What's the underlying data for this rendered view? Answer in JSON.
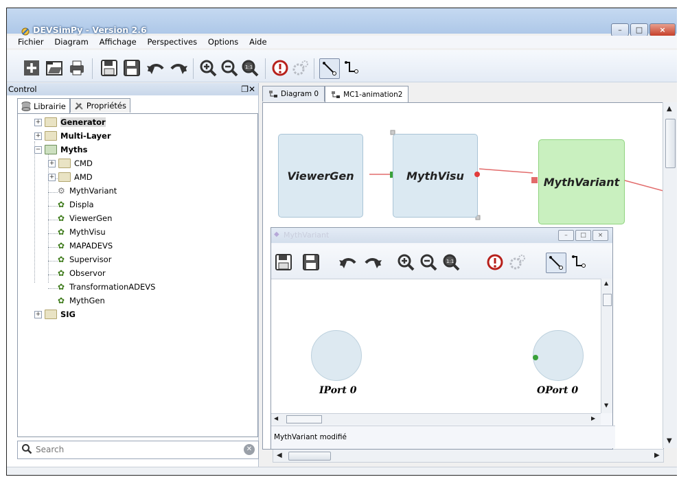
{
  "window": {
    "title": "DEVSimPy - Version 2.6",
    "buttons": {
      "minimize": "–",
      "maximize": "□",
      "close": "×"
    }
  },
  "menu": [
    "Fichier",
    "Diagram",
    "Affichage",
    "Perspectives",
    "Options",
    "Aide"
  ],
  "toolbar": {
    "icons": [
      "new-icon",
      "open-icon",
      "print-icon",
      "save-icon",
      "save-as-icon",
      "undo-icon",
      "redo-icon",
      "zoom-in-icon",
      "zoom-out-icon",
      "zoom-reset-icon",
      "check-icon",
      "simulate-icon",
      "connect-line-icon",
      "connect-curve-icon"
    ]
  },
  "control_panel": {
    "title": "Control",
    "controls": "❐✕",
    "tabs": [
      "Librairie",
      "Propriétés"
    ],
    "tree": [
      {
        "label": "Generator",
        "expander": "+",
        "bold": true
      },
      {
        "label": "Multi-Layer",
        "expander": "+",
        "bold": true
      },
      {
        "label": "Myths",
        "expander": "−",
        "bold": true
      },
      {
        "label": "CMD",
        "expander": "+"
      },
      {
        "label": "AMD",
        "expander": "+"
      },
      {
        "label": "MythVariant"
      },
      {
        "label": "Displa"
      },
      {
        "label": "ViewerGen"
      },
      {
        "label": "MythVisu"
      },
      {
        "label": "MAPADEVS"
      },
      {
        "label": "Supervisor"
      },
      {
        "label": "Observor"
      },
      {
        "label": "TransformationADEVS"
      },
      {
        "label": "MythGen"
      },
      {
        "label": "SIG",
        "expander": "+",
        "bold": true
      }
    ],
    "search_placeholder": "Search"
  },
  "diagram_tabs": [
    "Diagram 0",
    "MC1-animation2"
  ],
  "diagram_blocks": [
    {
      "label": "ViewerGen",
      "color": "#dbe9f2"
    },
    {
      "label": "MythVisu",
      "color": "#dbe9f2"
    },
    {
      "label": "MythVariant",
      "color": "#c9f0bf"
    }
  ],
  "subwindow": {
    "title": "MythVariant",
    "ports": [
      "IPort 0",
      "OPort 0"
    ],
    "status": "MythVariant modifié"
  },
  "colors": {
    "connection": "#e26b6b",
    "port_in": "#3aa13a",
    "port_out": "#e23b3b",
    "green_block": "#c9f0bf",
    "blue_block": "#dbe9f2"
  }
}
